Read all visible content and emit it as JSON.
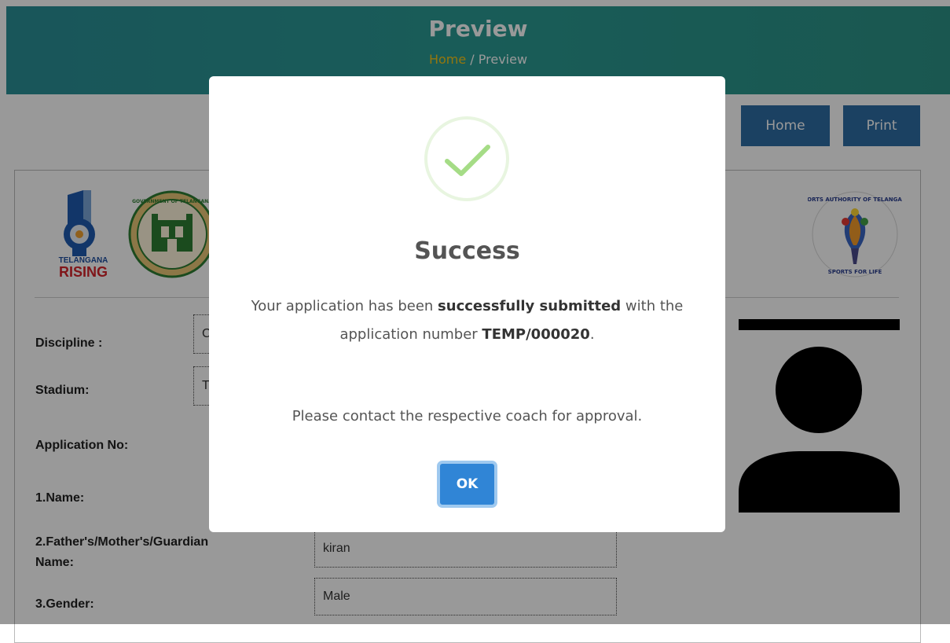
{
  "header": {
    "title": "Preview",
    "breadcrumb_home": "Home",
    "breadcrumb_separator": " / ",
    "breadcrumb_current": "Preview"
  },
  "toolbar": {
    "home_label": "Home",
    "print_label": "Print"
  },
  "logos": {
    "rising_line1": "TELANGANA",
    "rising_line2": "RISING",
    "seal_text": "GOVERNMENT OF TELANGANA",
    "sat_top": "SPORTS AUTHORITY OF TELANGANA",
    "sat_bottom": "SPORTS FOR LIFE"
  },
  "form": {
    "discipline_label": "Discipline :",
    "discipline_value": "C",
    "stadium_label": "Stadium:",
    "stadium_value": "T",
    "application_no_label": "Application No:",
    "name_label": "1.Name:",
    "guardian_label_line1": "2.Father's/Mother's/Guardian",
    "guardian_label_line2": "Name:",
    "guardian_value": "kiran",
    "gender_label": "3.Gender:",
    "gender_value": "Male"
  },
  "modal": {
    "title": "Success",
    "msg_part1": "Your application has been ",
    "msg_bold1": "successfully submitted",
    "msg_part2": " with the application number ",
    "application_number": "TEMP/000020",
    "msg_part3": ".",
    "note": "Please contact the respective coach for approval.",
    "ok_label": "OK"
  },
  "colors": {
    "banner": "#2a9a93",
    "button": "#2e6da4",
    "accent_home": "#f5c518",
    "success": "#a5dc86",
    "ok": "#3085d6"
  }
}
